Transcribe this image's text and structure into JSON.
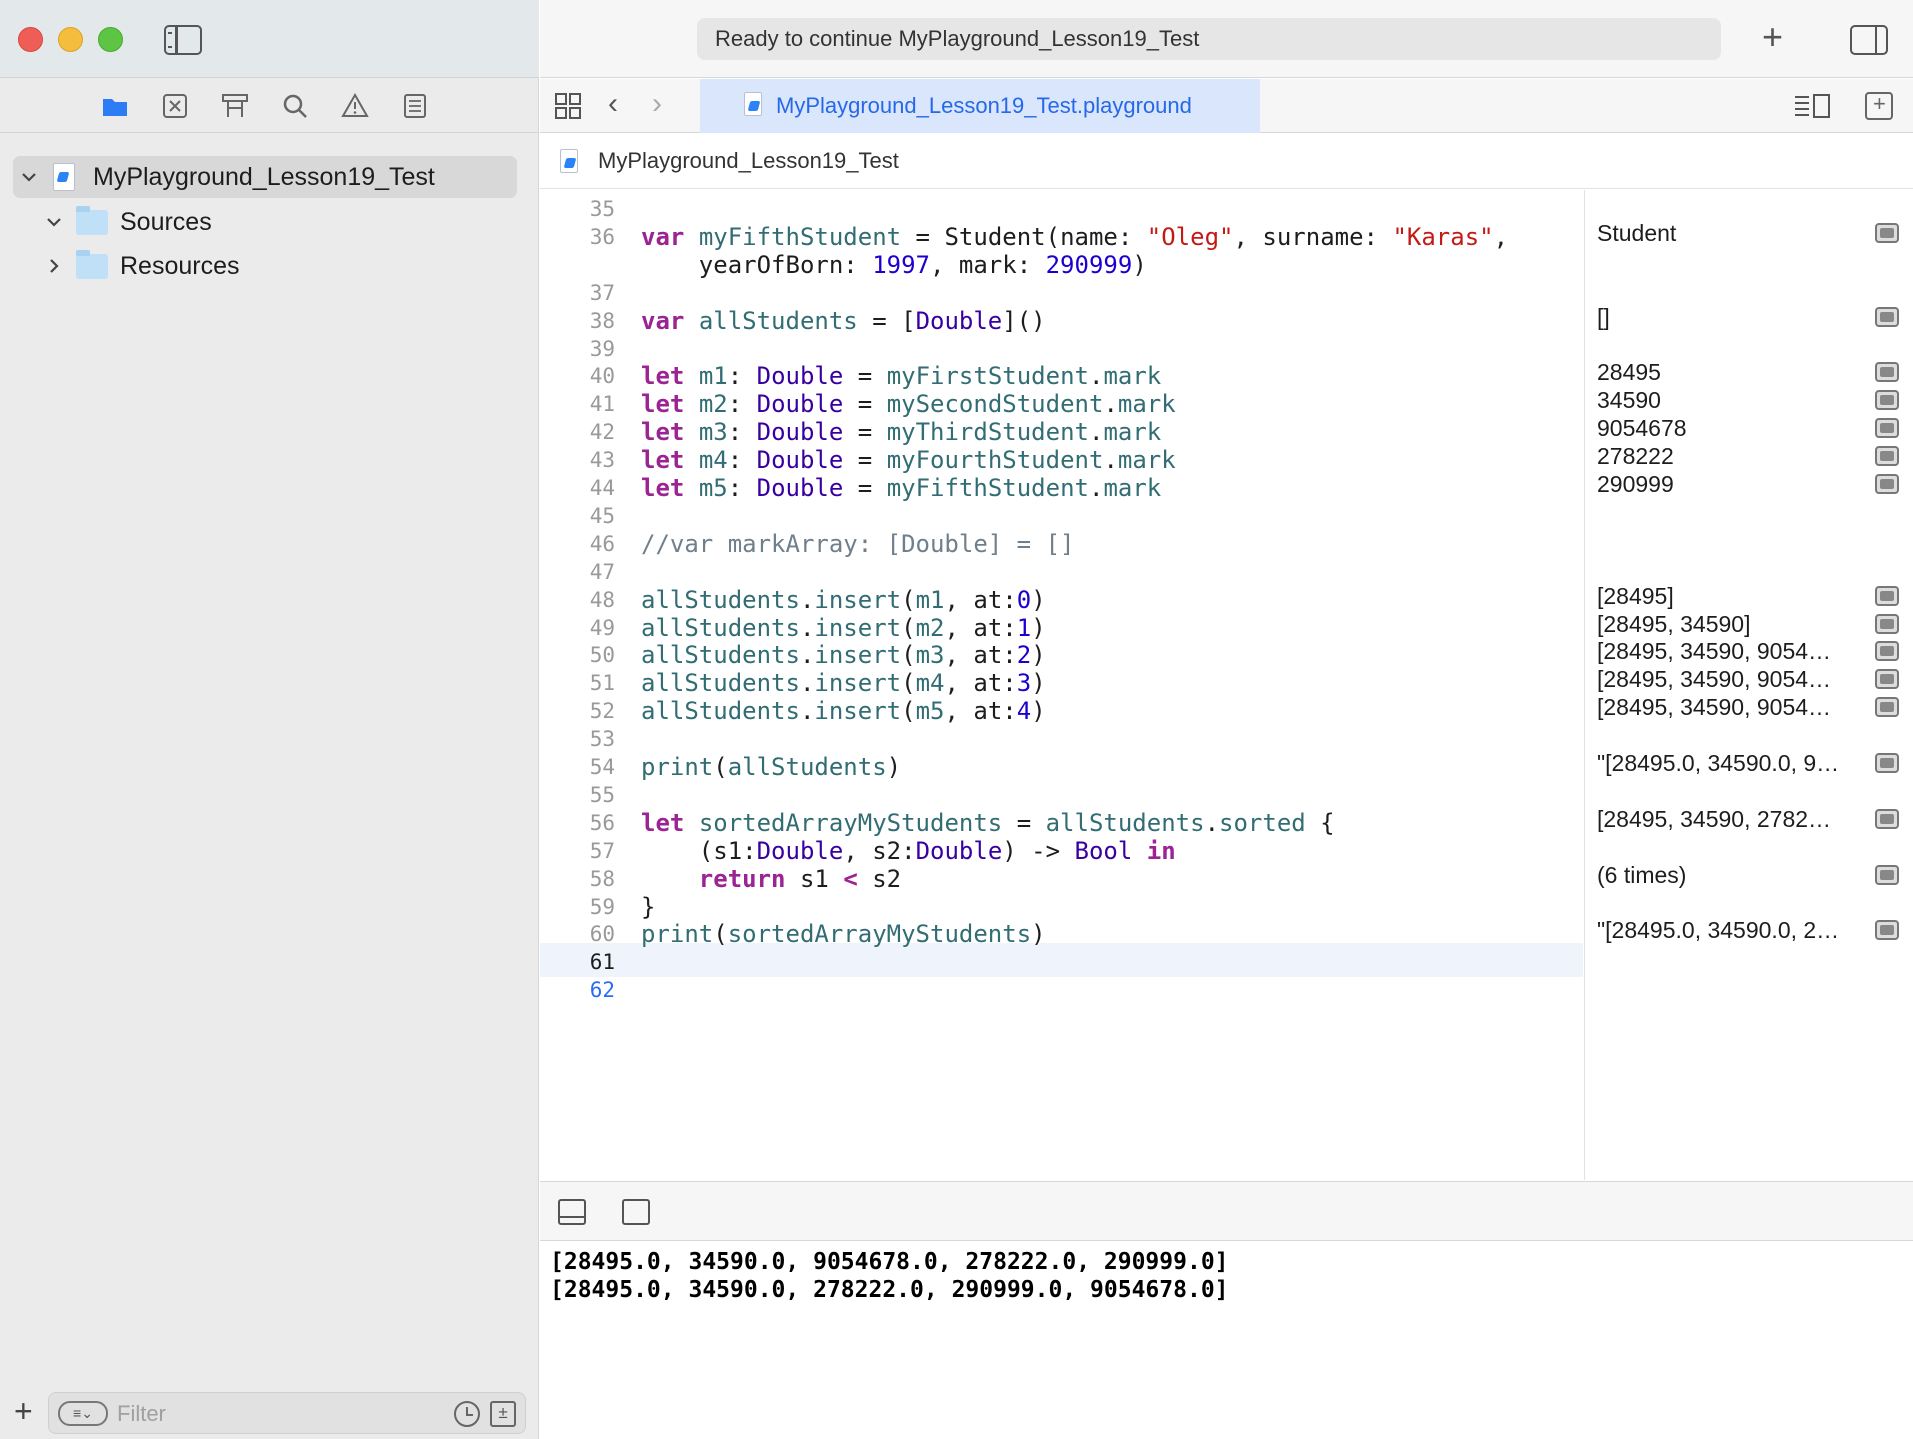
{
  "sidebar": {
    "navigator_icons": [
      "folder-icon",
      "source-control-icon",
      "symbol-icon",
      "search-icon",
      "warning-icon",
      "report-icon"
    ],
    "tree": {
      "project": "MyPlayground_Lesson19_Test",
      "sources": "Sources",
      "resources": "Resources"
    },
    "filter": {
      "placeholder": "Filter"
    }
  },
  "titlebar": {
    "activity": "Ready to continue MyPlayground_Lesson19_Test"
  },
  "tab": {
    "label": "MyPlayground_Lesson19_Test.playground"
  },
  "jumpbar": {
    "label": "MyPlayground_Lesson19_Test"
  },
  "editor": {
    "lines": [
      {
        "n": "35",
        "t": ""
      },
      {
        "n": "36",
        "t": "var myFifthStudent = Student(name: \"Oleg\", surname: \"Karas\","
      },
      {
        "n": "",
        "t": "    yearOfBorn: 1997, mark: 290999)"
      },
      {
        "n": "37",
        "t": ""
      },
      {
        "n": "38",
        "t": "var allStudents = [Double]()"
      },
      {
        "n": "39",
        "t": ""
      },
      {
        "n": "40",
        "t": "let m1: Double = myFirstStudent.mark"
      },
      {
        "n": "41",
        "t": "let m2: Double = mySecondStudent.mark"
      },
      {
        "n": "42",
        "t": "let m3: Double = myThirdStudent.mark"
      },
      {
        "n": "43",
        "t": "let m4: Double = myFourthStudent.mark"
      },
      {
        "n": "44",
        "t": "let m5: Double = myFifthStudent.mark"
      },
      {
        "n": "45",
        "t": ""
      },
      {
        "n": "46",
        "t": "//var markArray: [Double] = []"
      },
      {
        "n": "47",
        "t": ""
      },
      {
        "n": "48",
        "t": "allStudents.insert(m1, at:0)"
      },
      {
        "n": "49",
        "t": "allStudents.insert(m2, at:1)"
      },
      {
        "n": "50",
        "t": "allStudents.insert(m3, at:2)"
      },
      {
        "n": "51",
        "t": "allStudents.insert(m4, at:3)"
      },
      {
        "n": "52",
        "t": "allStudents.insert(m5, at:4)"
      },
      {
        "n": "53",
        "t": ""
      },
      {
        "n": "54",
        "t": "print(allStudents)"
      },
      {
        "n": "55",
        "t": ""
      },
      {
        "n": "56",
        "t": "let sortedArrayMyStudents = allStudents.sorted {"
      },
      {
        "n": "57",
        "t": "    (s1:Double, s2:Double) -> Bool in"
      },
      {
        "n": "58",
        "t": "    return s1 < s2"
      },
      {
        "n": "59",
        "t": "}"
      },
      {
        "n": "60",
        "t": "print(sortedArrayMyStudents)"
      },
      {
        "n": "61",
        "t": ""
      },
      {
        "n": "62",
        "t": ""
      }
    ]
  },
  "results": [
    {
      "line": "36",
      "text": "Student"
    },
    {
      "line": "38",
      "text": "[]"
    },
    {
      "line": "40",
      "text": "28495"
    },
    {
      "line": "41",
      "text": "34590"
    },
    {
      "line": "42",
      "text": "9054678"
    },
    {
      "line": "43",
      "text": "278222"
    },
    {
      "line": "44",
      "text": "290999"
    },
    {
      "line": "48",
      "text": "[28495]"
    },
    {
      "line": "49",
      "text": "[28495, 34590]"
    },
    {
      "line": "50",
      "text": "[28495, 34590, 9054…"
    },
    {
      "line": "51",
      "text": "[28495, 34590, 9054…"
    },
    {
      "line": "52",
      "text": "[28495, 34590, 9054…"
    },
    {
      "line": "54",
      "text": "\"[28495.0, 34590.0, 9…"
    },
    {
      "line": "56",
      "text": "[28495, 34590, 2782…"
    },
    {
      "line": "58",
      "text": "(6 times)"
    },
    {
      "line": "60",
      "text": "\"[28495.0, 34590.0, 2…"
    }
  ],
  "console": {
    "lines": [
      "[28495.0, 34590.0, 9054678.0, 278222.0, 290999.0]",
      "[28495.0, 34590.0, 278222.0, 290999.0, 9054678.0]"
    ]
  }
}
